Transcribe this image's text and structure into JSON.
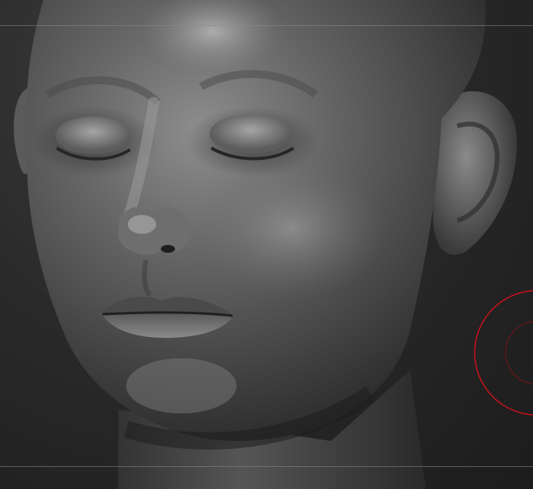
{
  "viewport": {
    "kind": "3d-sculpt-viewport",
    "subject": "sculpted-head-model"
  },
  "brush": {
    "outer_ring_color": "#c8121a",
    "inner_ring_color": "#7a1216"
  },
  "colors": {
    "background": "#2a2a2a",
    "guide_line": "#8a8a8a",
    "clay_light": "#9a9a9a",
    "clay_dark": "#3a3a3a"
  }
}
